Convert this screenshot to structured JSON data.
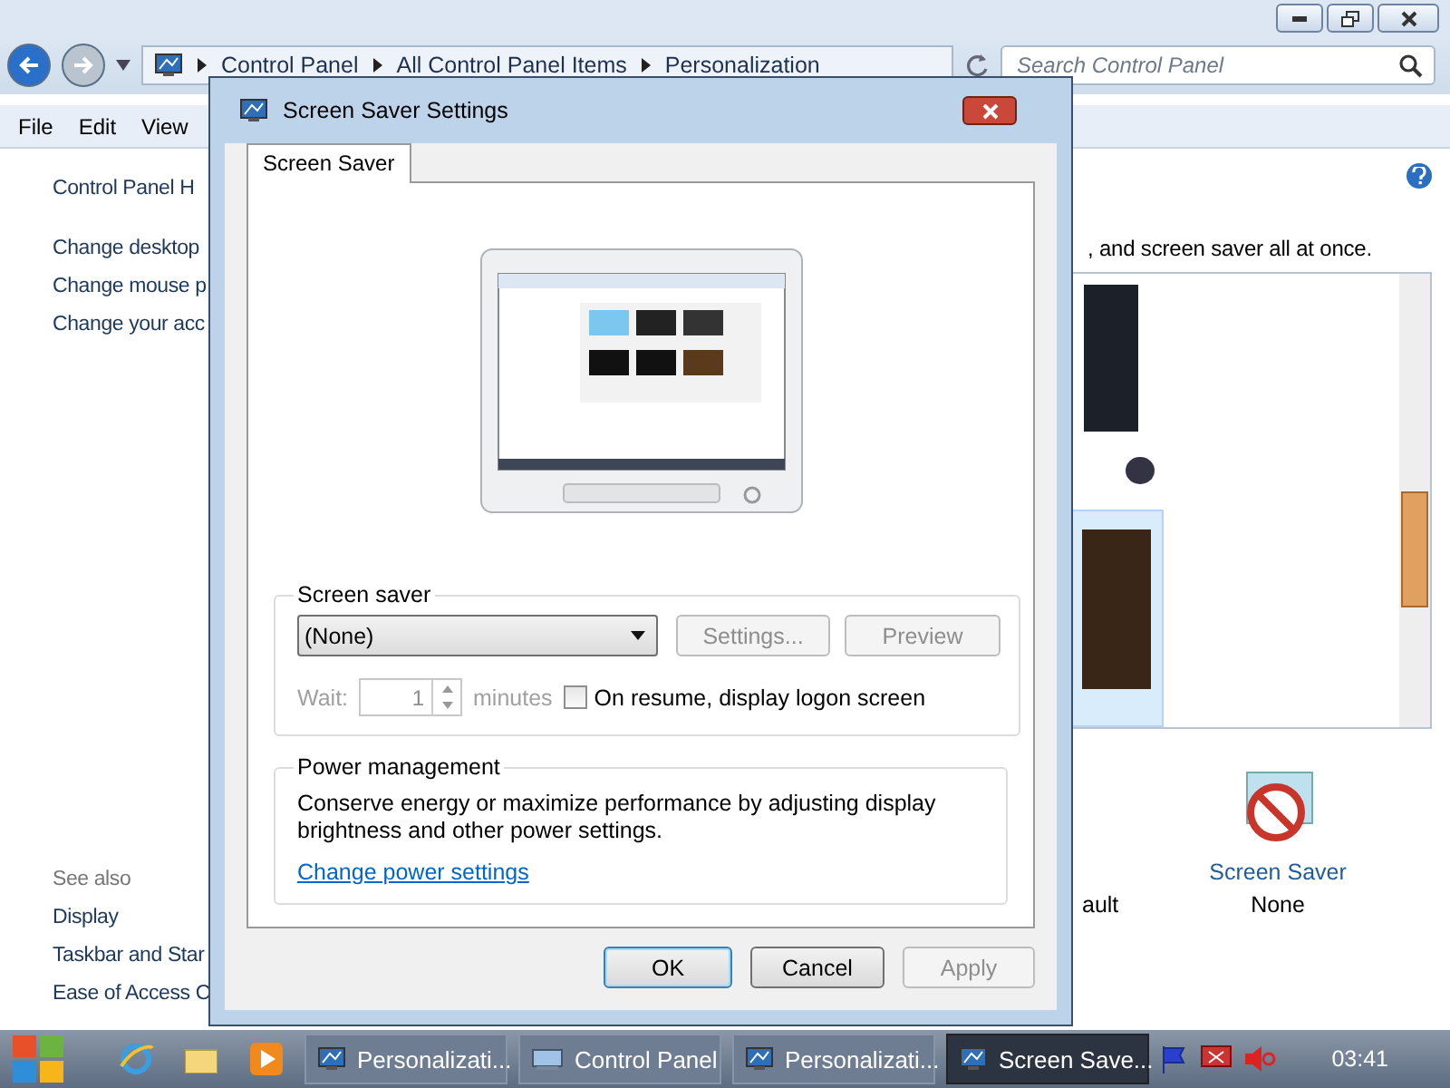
{
  "address_bar": {
    "breadcrumb": [
      "Control Panel",
      "All Control Panel Items",
      "Personalization"
    ],
    "search": {
      "placeholder": "Search Control Panel"
    }
  },
  "menu": [
    "File",
    "Edit",
    "View"
  ],
  "sidebar": {
    "home": "Control Panel H",
    "links": [
      "Change desktop",
      "Change mouse p",
      "Change your acc"
    ],
    "see_also": {
      "heading": "See also",
      "links": [
        "Display",
        "Taskbar and Star",
        "Ease of Access C"
      ]
    }
  },
  "main": {
    "intro": ", and screen saver all at once.",
    "partial_label": "ault",
    "screen_saver_item": {
      "label": "Screen Saver",
      "value": "None"
    }
  },
  "dialog": {
    "title": "Screen Saver Settings",
    "tabs": [
      {
        "label": "Screen Saver",
        "selected": true
      }
    ],
    "screen_saver": {
      "heading": "Screen saver",
      "selection": "(None)",
      "buttons": [
        {
          "label": "Settings...",
          "disabled": true
        },
        {
          "label": "Preview",
          "disabled": true
        }
      ],
      "wait_label": "Wait:",
      "wait_value": "1",
      "wait_unit": "minutes",
      "wait_disabled": true,
      "logon": {
        "label": "On resume, display logon screen",
        "checked": false
      }
    },
    "power": {
      "heading": "Power management",
      "text": "Conserve energy or maximize performance by adjusting display brightness and other power settings.",
      "link": "Change power settings"
    },
    "buttons": [
      {
        "label": "OK",
        "default": true,
        "disabled": false
      },
      {
        "label": "Cancel",
        "default": false,
        "disabled": false
      },
      {
        "label": "Apply",
        "default": false,
        "disabled": true
      }
    ]
  },
  "taskbar": {
    "tasks": [
      {
        "label": "Personalizati...",
        "kind": "monitor",
        "selected": false
      },
      {
        "label": "Control Panel",
        "kind": "control-panel",
        "selected": false
      },
      {
        "label": "Personalizati...",
        "kind": "monitor",
        "selected": false
      },
      {
        "label": "Screen Save...",
        "kind": "monitor",
        "selected": true
      }
    ],
    "clock": "03:41"
  }
}
